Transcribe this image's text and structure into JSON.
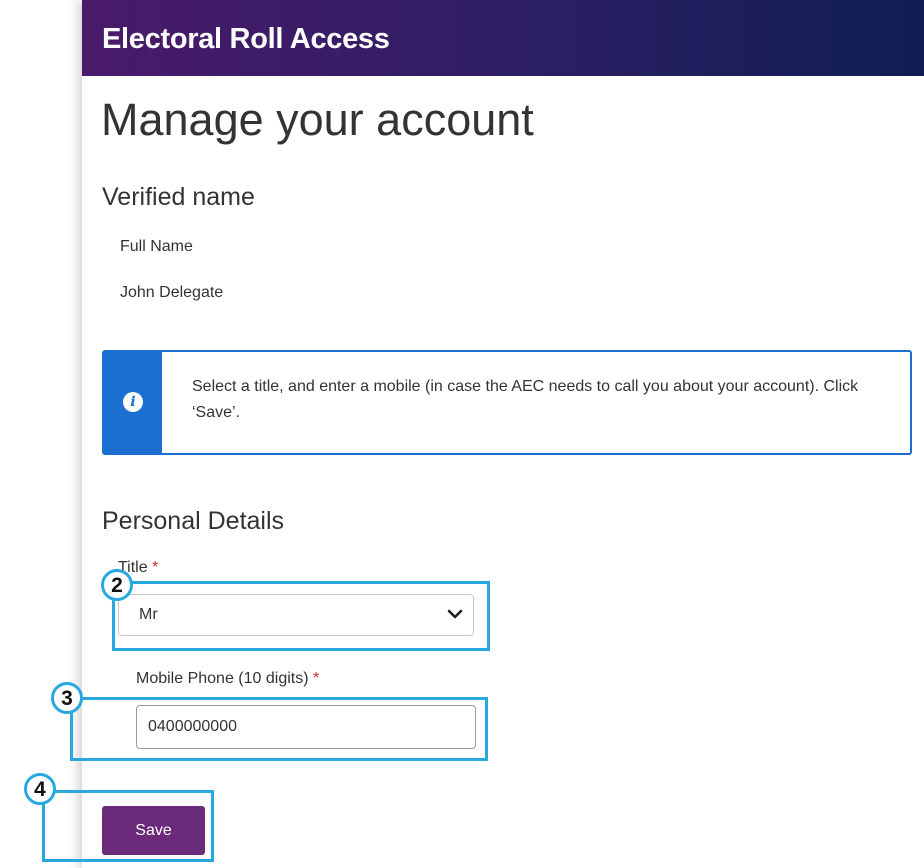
{
  "header": {
    "title": "Electoral Roll Access"
  },
  "page": {
    "title": "Manage your account"
  },
  "verified_name": {
    "heading": "Verified name",
    "label": "Full Name",
    "value": "John Delegate"
  },
  "info": {
    "icon": "info-icon",
    "text": "Select a title, and enter a mobile (in case the AEC needs to call you about your account). Click ‘Save’."
  },
  "personal_details": {
    "heading": "Personal Details",
    "title_field": {
      "label": "Title",
      "required_marker": "*",
      "selected": "Mr"
    },
    "mobile_field": {
      "label": "Mobile Phone (10 digits)",
      "required_marker": "*",
      "value": "0400000000"
    }
  },
  "actions": {
    "save_label": "Save"
  },
  "callouts": [
    "2",
    "3",
    "4"
  ],
  "colors": {
    "header_start": "#4a1a6b",
    "header_end": "#101e55",
    "info_blue": "#1a6fd1",
    "save_purple": "#6b2a7a",
    "callout_blue": "#29a8e0",
    "required_red": "#d9262e"
  }
}
